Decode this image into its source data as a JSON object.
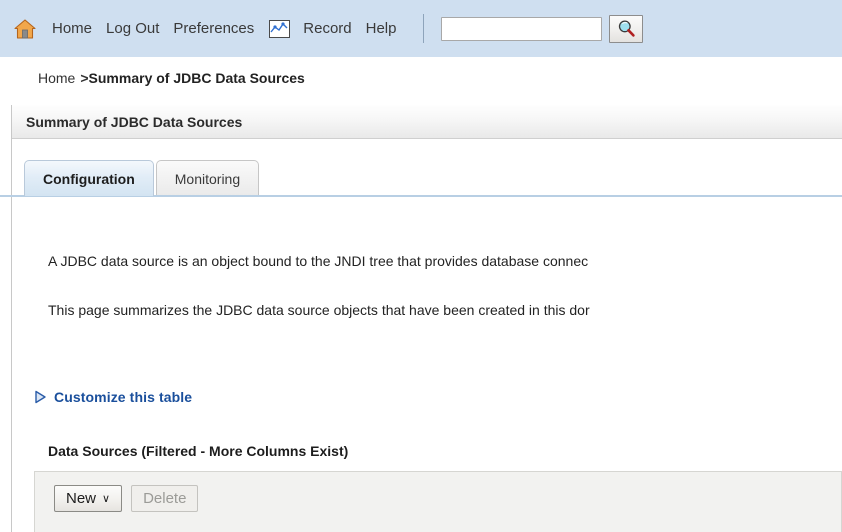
{
  "toolbar": {
    "home_icon": "home-icon",
    "links": [
      {
        "label": "Home",
        "name": "toolbar-link-home"
      },
      {
        "label": "Log Out",
        "name": "toolbar-link-log-out"
      },
      {
        "label": "Preferences",
        "name": "toolbar-link-preferences"
      }
    ],
    "record_icon": "chart-record-icon",
    "record_label": "Record",
    "help_label": "Help",
    "search": {
      "value": "",
      "placeholder": ""
    },
    "search_button_icon": "magnifier-icon",
    "background_color": "#cfdff0"
  },
  "breadcrumb": {
    "home": "Home",
    "separator": ">",
    "current": "Summary of JDBC Data Sources"
  },
  "page": {
    "header_title": "Summary of JDBC Data Sources"
  },
  "tabs": [
    {
      "label": "Configuration",
      "active": true,
      "name": "tab-configuration"
    },
    {
      "label": "Monitoring",
      "active": false,
      "name": "tab-monitoring"
    }
  ],
  "body": {
    "paragraph_1": "A JDBC data source is an object bound to the JNDI tree that provides database connec",
    "paragraph_2": "This page summarizes the JDBC data source objects that have been created in this dor"
  },
  "customize": {
    "icon": "triangle-right-icon",
    "label": "Customize this table",
    "link_color": "#1a4f9c"
  },
  "data_sources": {
    "title": "Data Sources (Filtered - More Columns Exist)",
    "buttons": {
      "new_label": "New",
      "new_caret": "∨",
      "delete_label": "Delete"
    }
  }
}
